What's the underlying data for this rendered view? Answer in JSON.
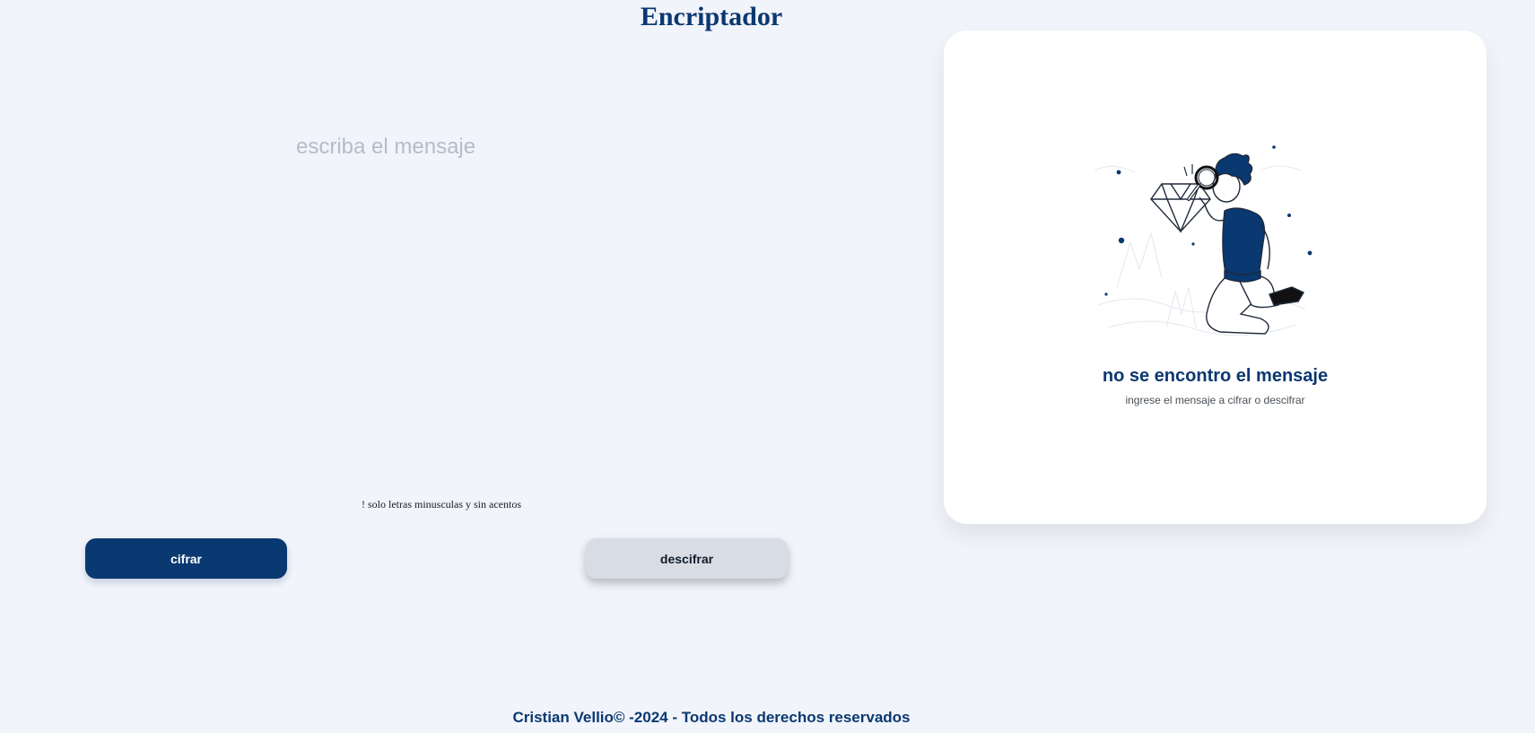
{
  "header": {
    "title": "Encriptador"
  },
  "input": {
    "placeholder": "escriba el mensaje",
    "value": ""
  },
  "warning": {
    "text": "! solo letras minusculas y sin acentos"
  },
  "buttons": {
    "encrypt_label": "cifrar",
    "decrypt_label": "descifrar"
  },
  "output": {
    "empty_title": "no se encontro el mensaje",
    "empty_subtitle": "ingrese el mensaje a cifrar o descifrar",
    "illustration": "person-with-magnifier-diamond-illustration"
  },
  "footer": {
    "text": "Cristian Vellio© -2024 - Todos los derechos reservados"
  },
  "colors": {
    "background": "#f1f4fa",
    "primary": "#0a3871",
    "secondary_button": "#d8dde5",
    "card": "#ffffff",
    "placeholder": "#b4bccb"
  }
}
